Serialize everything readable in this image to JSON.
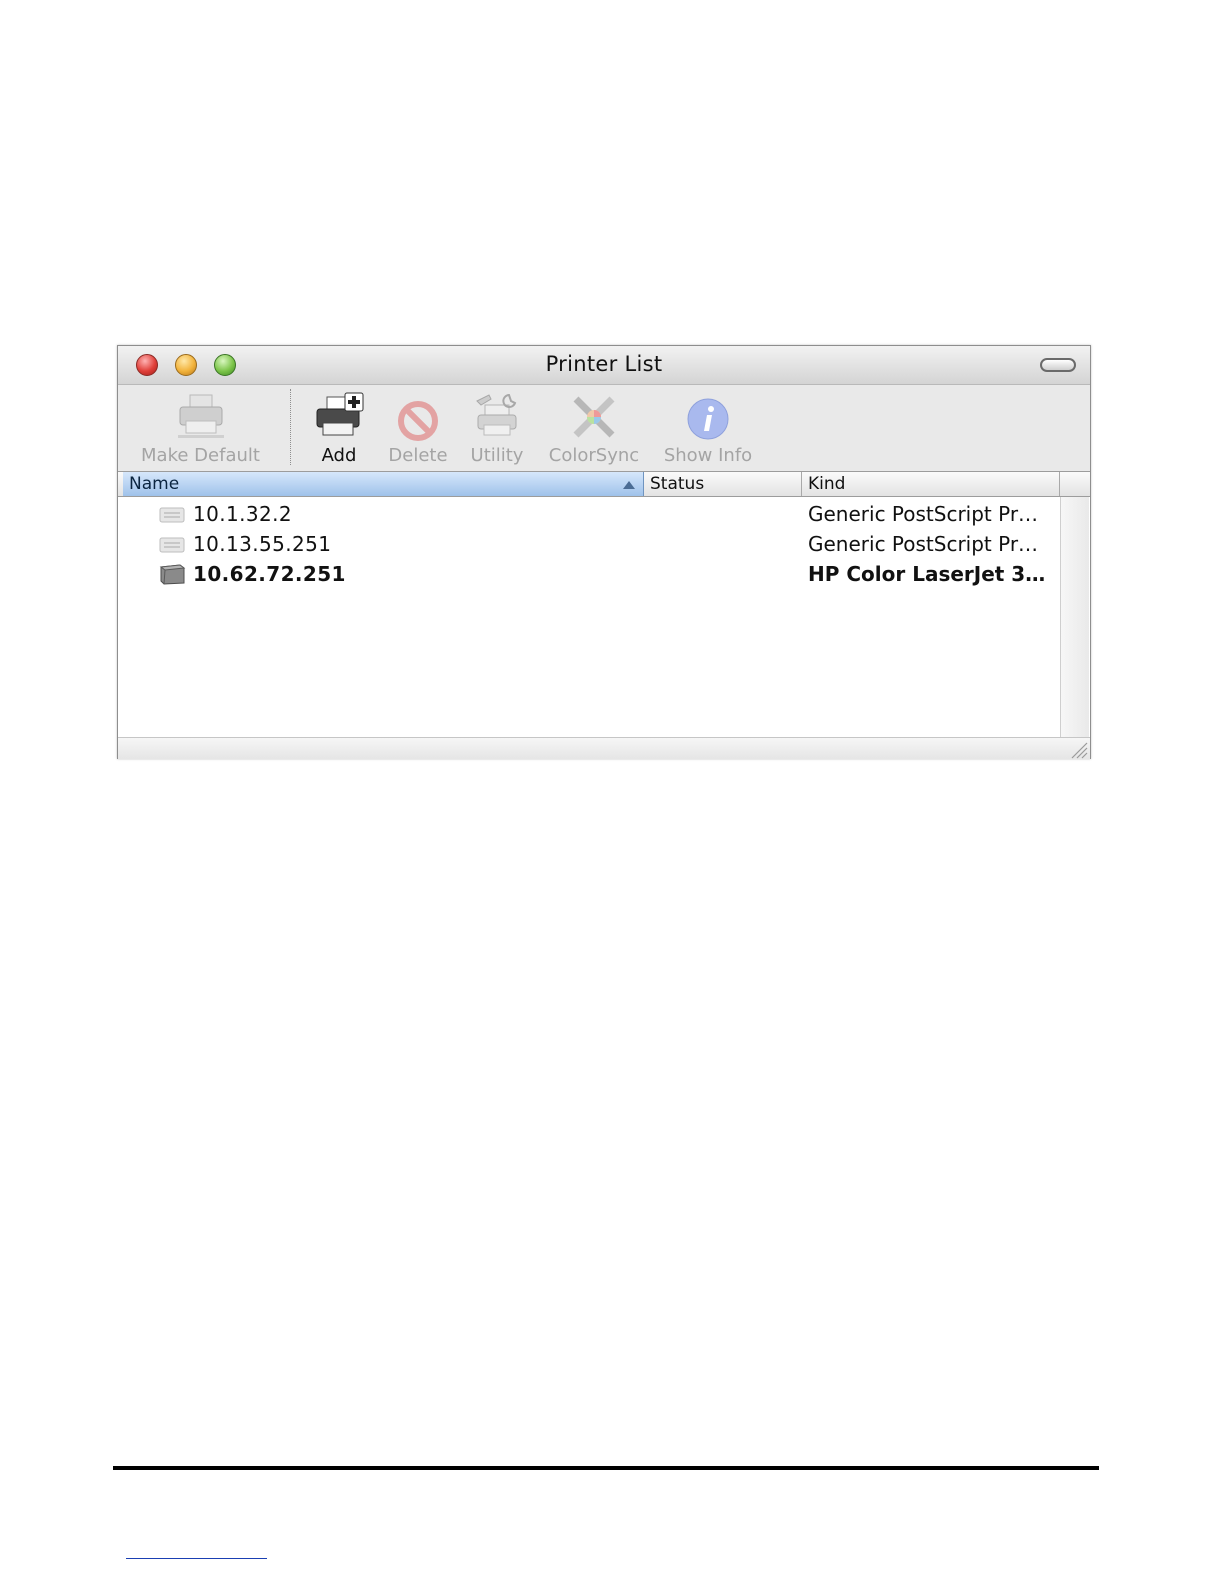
{
  "window": {
    "title": "Printer List"
  },
  "toolbar": {
    "buttons": [
      {
        "label": "Make Default",
        "icon": "printer-icon",
        "enabled": false
      },
      {
        "label": "Add",
        "icon": "add-printer-icon",
        "enabled": true
      },
      {
        "label": "Delete",
        "icon": "delete-icon",
        "enabled": false
      },
      {
        "label": "Utility",
        "icon": "utility-icon",
        "enabled": false
      },
      {
        "label": "ColorSync",
        "icon": "colorsync-icon",
        "enabled": false
      },
      {
        "label": "Show Info",
        "icon": "info-icon",
        "enabled": false
      }
    ]
  },
  "table": {
    "columns": {
      "name": "Name",
      "status": "Status",
      "kind": "Kind"
    },
    "sort_column": "Name",
    "sort_direction": "ascending",
    "rows": [
      {
        "name": "10.1.32.2",
        "status": "",
        "kind": "Generic PostScript Pr…",
        "icon": "generic-printer-icon",
        "bold": false
      },
      {
        "name": "10.13.55.251",
        "status": "",
        "kind": "Generic PostScript Pr…",
        "icon": "generic-printer-icon",
        "bold": false
      },
      {
        "name": "10.62.72.251",
        "status": "",
        "kind": "HP Color LaserJet 3…",
        "icon": "laser-printer-icon",
        "bold": true
      }
    ]
  },
  "colors": {
    "selected_header": "#9fc2ea",
    "disabled_text": "#a4a4a4"
  }
}
